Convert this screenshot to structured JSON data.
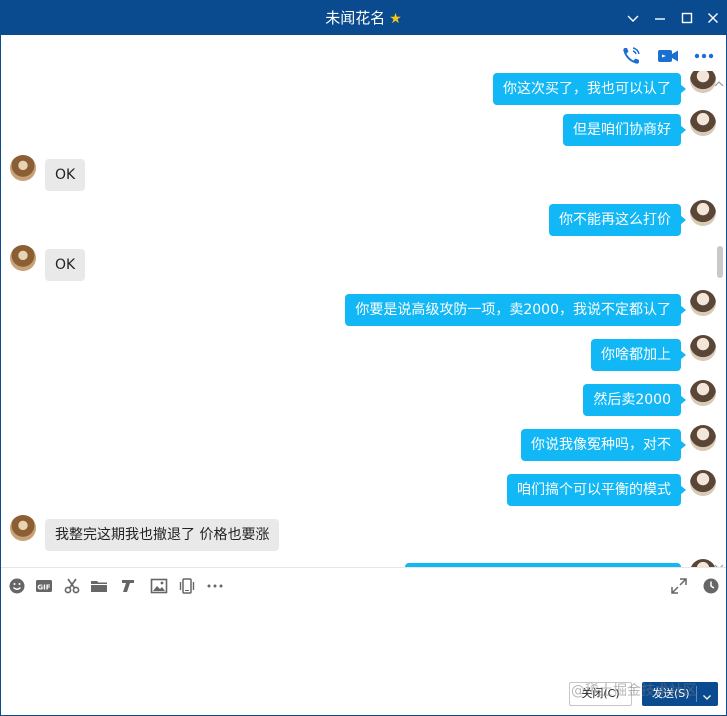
{
  "window": {
    "title": "未闻花名",
    "star_glyph": "★"
  },
  "colors": {
    "titlebar": "#0a4a8f",
    "my_bubble": "#12b7f5",
    "other_bubble": "#e9e9e9",
    "send_button": "#0a4a8f"
  },
  "title_controls": [
    "chevron-down-icon",
    "minimize-icon",
    "maximize-icon",
    "close-icon"
  ],
  "top_actions": [
    "phone-call-icon",
    "video-call-icon",
    "more-icon"
  ],
  "messages": [
    {
      "from": "me",
      "text": "你这次买了，我也可以认了"
    },
    {
      "from": "me",
      "text": "但是咱们协商好"
    },
    {
      "from": "other",
      "text": "OK"
    },
    {
      "from": "me",
      "text": "你不能再这么打价"
    },
    {
      "from": "other",
      "text": "OK"
    },
    {
      "from": "me",
      "text": "你要是说高级攻防一项，卖2000，我说不定都认了"
    },
    {
      "from": "me",
      "text": "你啥都加上"
    },
    {
      "from": "me",
      "text": "然后卖2000"
    },
    {
      "from": "me",
      "text": "你说我像冤种吗，对不"
    },
    {
      "from": "me",
      "text": "咱们搞个可以平衡的模式"
    },
    {
      "from": "other",
      "text": "我整完这期我也撤退了 价格也要涨"
    }
  ],
  "input_tools": [
    "emoji-icon",
    "gif-icon",
    "scissors-icon",
    "folder-icon",
    "music-icon",
    "image-icon",
    "shake-icon",
    "more-tools-icon"
  ],
  "input_right_tools": [
    "expand-icon",
    "history-clock-icon"
  ],
  "input": {
    "value": "",
    "placeholder": ""
  },
  "buttons": {
    "close_label": "关闭(C)",
    "send_label": "发送(S)"
  },
  "watermark": "@稀土掘金技术社区"
}
